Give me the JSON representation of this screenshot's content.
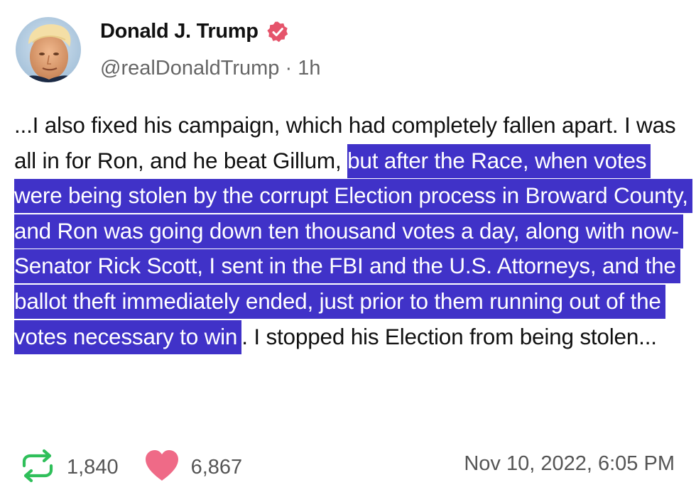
{
  "author": {
    "display_name": "Donald J. Trump",
    "handle": "@realDonaldTrump",
    "separator": "·",
    "age": "1h",
    "verified_icon": "verified-badge-icon",
    "avatar_icon": "profile-avatar"
  },
  "post": {
    "text_before": "...I also fixed his campaign, which had completely fallen apart. I was all in for Ron, and he beat Gillum, ",
    "text_highlighted": "but after the Race, when votes were being stolen by the corrupt Election process in Broward County, and Ron was going down ten thousand votes a day, along with now-Senator Rick Scott, I sent in the FBI and the U.S. Attorneys, and the ballot theft immediately ended, just prior to them running out of the votes necessary to win",
    "text_after": ". I stopped his Election from being stolen..."
  },
  "stats": {
    "reposts": "1,840",
    "likes": "6,867",
    "repost_icon": "repost-icon",
    "like_icon": "heart-icon"
  },
  "timestamp": "Nov 10, 2022, 6:05 PM",
  "colors": {
    "highlight": "#4032c8",
    "verified_badge": "#e5546b",
    "repost_icon": "#2fbf5a",
    "heart_icon": "#ef6a87",
    "muted_text": "#666666"
  }
}
